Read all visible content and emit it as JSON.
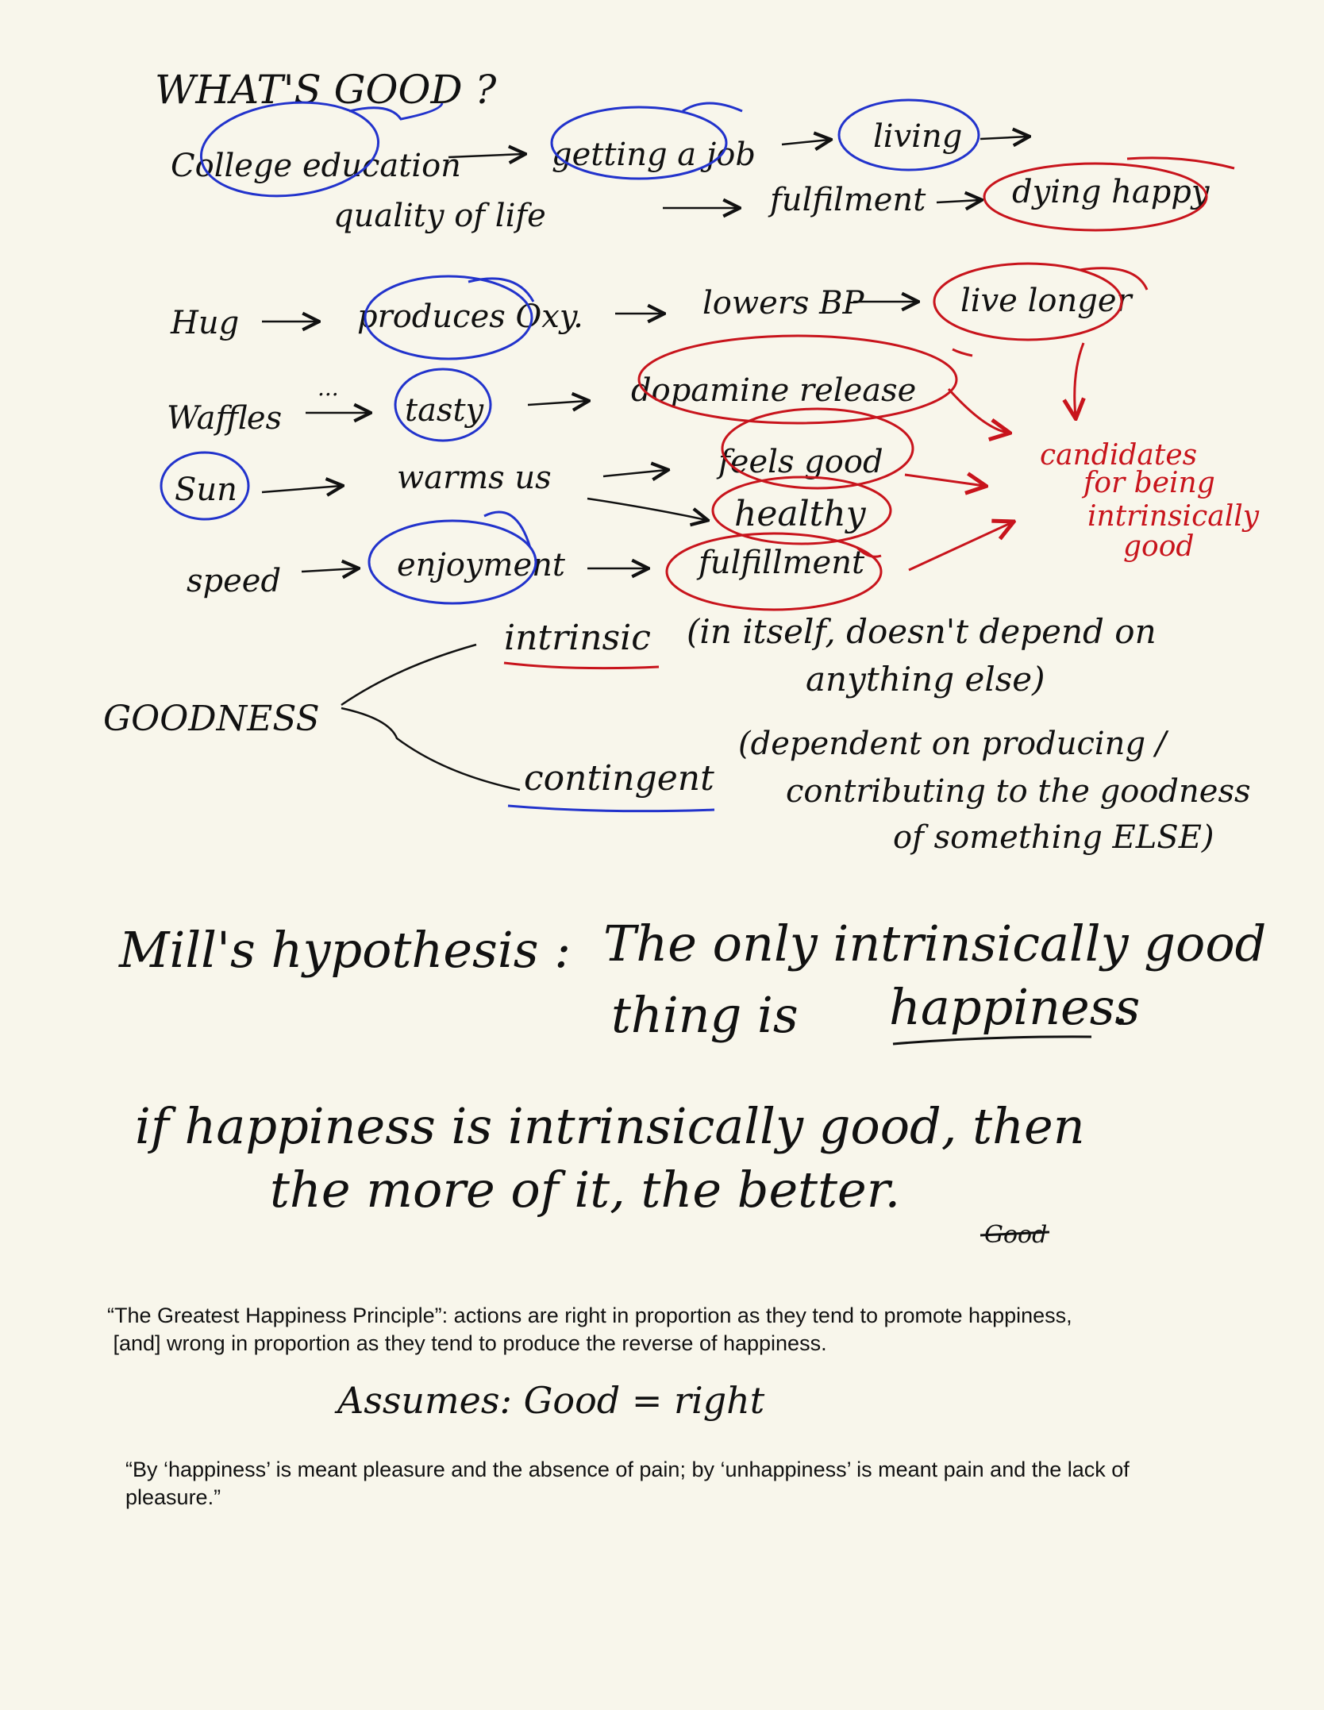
{
  "notes": {
    "title": "WHAT'S GOOD ?",
    "chain1": {
      "row1": [
        "College education",
        "getting a job",
        "living"
      ],
      "row2": [
        "quality of life",
        "fulfilment",
        "dying happy"
      ]
    },
    "chain_hug": [
      "Hug",
      "produces Oxy.",
      "lowers BP",
      "live longer"
    ],
    "chain_waffles": [
      "Waffles",
      "tasty",
      "dopamine release"
    ],
    "chain_sun": [
      "Sun",
      "warms us",
      "feels good",
      "healthy"
    ],
    "chain_speed": [
      "speed",
      "enjoyment",
      "fulfillment"
    ],
    "candidates_note": [
      "candidates",
      "for being",
      "intrinsically",
      "good"
    ],
    "goodness": {
      "label": "GOODNESS",
      "intrinsic_term": "intrinsic",
      "intrinsic_def_1": "(in itself, doesn't depend on",
      "intrinsic_def_2": "anything else)",
      "contingent_term": "contingent",
      "contingent_def_1": "(dependent on producing /",
      "contingent_def_2": "contributing to the goodness",
      "contingent_def_3": "of something ELSE)"
    },
    "mill_label": "Mill's hypothesis :",
    "mill_line1": "The only intrinsically good",
    "mill_line2_pre": "thing is",
    "mill_line2_word": "happiness",
    "mill_line2_post": ".",
    "if_line1": "if happiness is intrinsically good, then",
    "if_line2": "the more of it, the better.",
    "crossed_word": "Good",
    "assumes": "Assumes: Good = right"
  },
  "quotes": {
    "ghp_line1": "“The Greatest Happiness Principle”: actions are right in proportion as they tend to promote happiness,",
    "ghp_line2": " [and] wrong in proportion as they tend to produce the reverse of happiness.",
    "happiness_def_line1": "“By ‘happiness’ is meant pleasure and the absence of pain; by ‘unhappiness’ is meant pain and the lack of",
    "happiness_def_line2": "pleasure.”"
  },
  "colors": {
    "paper": "#f8f6eb",
    "ink_black": "#111111",
    "ink_blue": "#2233cc",
    "ink_red": "#c8141c"
  }
}
